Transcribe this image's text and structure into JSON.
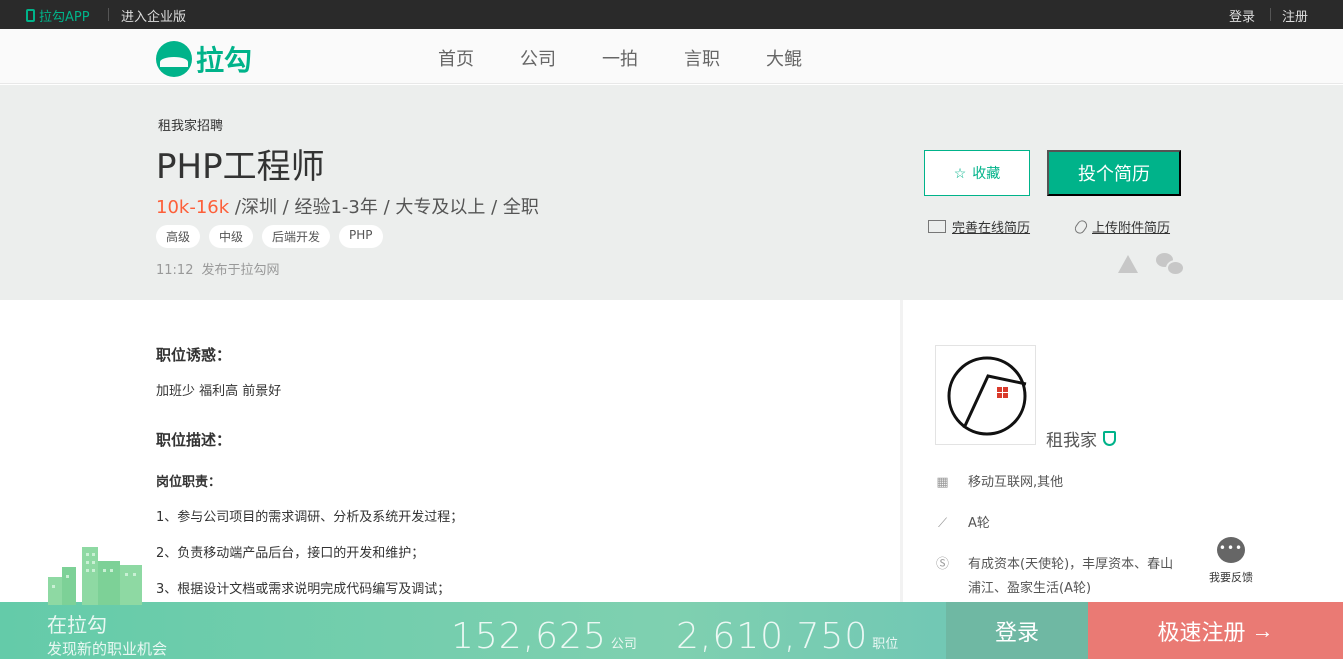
{
  "topbar": {
    "app": "拉勾APP",
    "enterprise": "进入企业版",
    "login": "登录",
    "register": "注册"
  },
  "nav": {
    "logo": "拉勾",
    "items": [
      "首页",
      "公司",
      "一拍",
      "言职",
      "大鲲"
    ]
  },
  "job": {
    "company": "租我家招聘",
    "title": "PHP工程师",
    "salary": "10k-16k",
    "meta": " /深圳 / 经验1-3年 / 大专及以上 / 全职",
    "tags": [
      "高级",
      "中级",
      "后端开发",
      "PHP"
    ],
    "time": "11:12",
    "source": "发布于拉勾网",
    "fav_label": "收藏",
    "apply_label": "投个简历",
    "online_resume": "完善在线简历",
    "attach_resume": "上传附件简历"
  },
  "detail": {
    "advantage_title": "职位诱惑：",
    "advantage": "加班少 福利高 前景好",
    "desc_title": "职位描述：",
    "duty_title": "岗位职责：",
    "duties": [
      "1、参与公司项目的需求调研、分析及系统开发过程；",
      "2、负责移动端产品后台，接口的开发和维护；",
      "3、根据设计文档或需求说明完成代码编写及调试；"
    ]
  },
  "company_card": {
    "name": "租我家",
    "field": "移动互联网,其他",
    "stage": "A轮",
    "investors": "有成资本(天使轮)，丰厚资本、春山浦江、盈家生活(A轮)"
  },
  "feedback": "我要反馈",
  "banner": {
    "title": "在拉勾",
    "subtitle": "发现新的职业机会",
    "companies": "152,625",
    "companies_unit": "公司",
    "jobs": "2,610,750",
    "jobs_unit": "职位",
    "login": "登录",
    "register": "极速注册"
  },
  "colors": {
    "brand": "#00b38a",
    "salary": "#fd5f39",
    "register": "#ea7a74"
  }
}
